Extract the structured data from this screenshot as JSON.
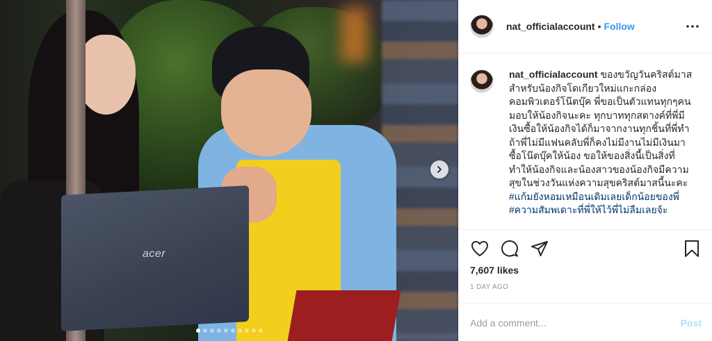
{
  "photo": {
    "laptop_brand": "acer",
    "carousel": {
      "count": 10,
      "active_index": 0
    },
    "next_icon": "chevron-right-icon"
  },
  "header": {
    "username": "nat_officialaccount",
    "separator": "•",
    "follow_label": "Follow",
    "more_icon": "more-horizontal-icon"
  },
  "caption": {
    "username": "nat_officialaccount",
    "text": "ของขวัญวันคริสต์มาสสำหรับน้องกิจโดเกียวใหม่แกะกล่อง คอมพิวเตอร์โน๊ตบุ๊ค พี่ขอเป็นตัวแทนทุกๆคนมอบให้น้องกิจนะคะ ทุกบาททุกสตางค์ที่พี่มีเงินซื้อให้น้องกิจได้ก็มาจากงานทุกชิ้นที่พี่ทำ ถ้าพี่ไม่มีแฟนคลับพี่ก็คงไม่มีงานไม่มีเงินมาซื้อโน๊ตบุ๊คให้น้อง ขอให้ของสิ่งนี้เป็นสิ่งที่ทำให้น้องกิจและน้องสาวของน้องกิจมีความสุขในช่วงวันแห่งความสุขคริสต์มาสนี้นะคะ",
    "hashtags": "#แก้มยังหอมเหมือนเดิมเลยเด็กน้อยของพี่\n#ความสัมพเดาะที่พี่ให้ไว้พี่ไม่ลืมเลยจ้ะ"
  },
  "actions": {
    "like_icon": "heart-icon",
    "comment_icon": "comment-icon",
    "share_icon": "share-icon",
    "save_icon": "bookmark-icon"
  },
  "likes": "7,607 likes",
  "timestamp": "1 DAY AGO",
  "comment": {
    "placeholder": "Add a comment...",
    "post_label": "Post"
  },
  "colors": {
    "accent": "#3897f0",
    "post_disabled": "#b2dffc",
    "hashtag": "#003569",
    "muted": "#999999"
  }
}
